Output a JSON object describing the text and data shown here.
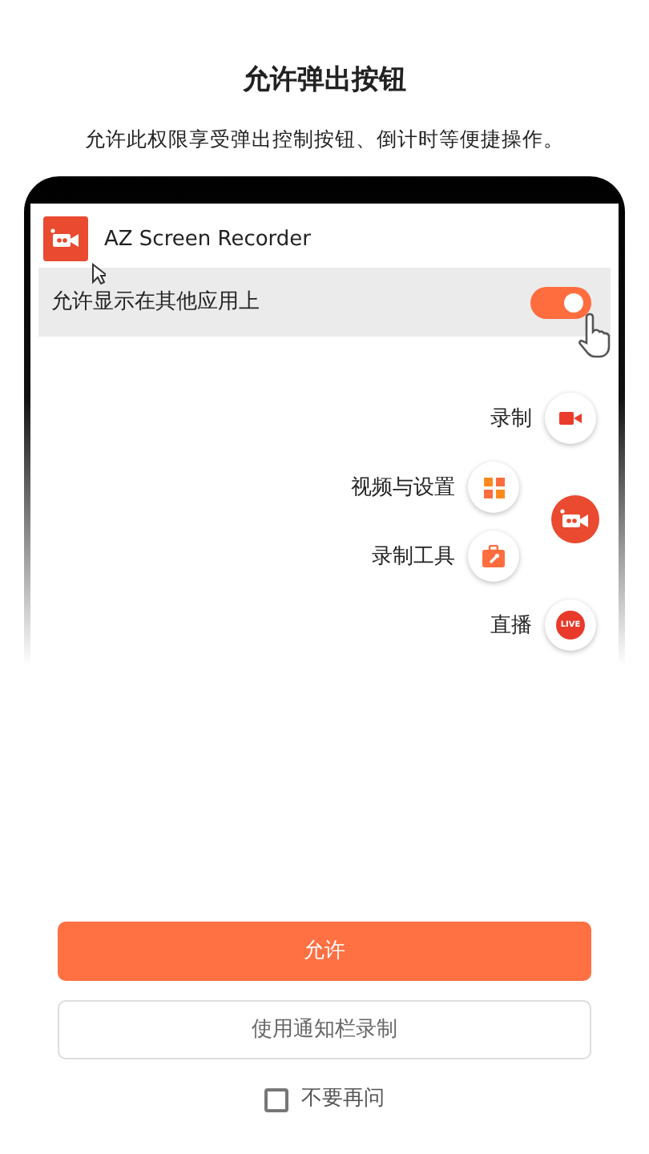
{
  "title": "允许弹出按钮",
  "subtitle": "允许此权限享受弹出控制按钮、倒计时等便捷操作。",
  "preview": {
    "app_name": "AZ Screen Recorder",
    "setting": {
      "label": "允许显示在其他应用上",
      "on": true
    },
    "menu_items": [
      {
        "label": "录制",
        "kind": "record"
      },
      {
        "label": "视频与设置",
        "kind": "grid"
      },
      {
        "label": "录制工具",
        "kind": "tools"
      },
      {
        "label": "直播",
        "kind": "live",
        "icon_text": "LIVE"
      }
    ]
  },
  "buttons": [
    {
      "label": "允许",
      "kind": "primary"
    },
    {
      "label": "使用通知栏录制",
      "kind": "outline"
    }
  ],
  "dont_ask": {
    "label": "不要再问",
    "checked": false
  }
}
